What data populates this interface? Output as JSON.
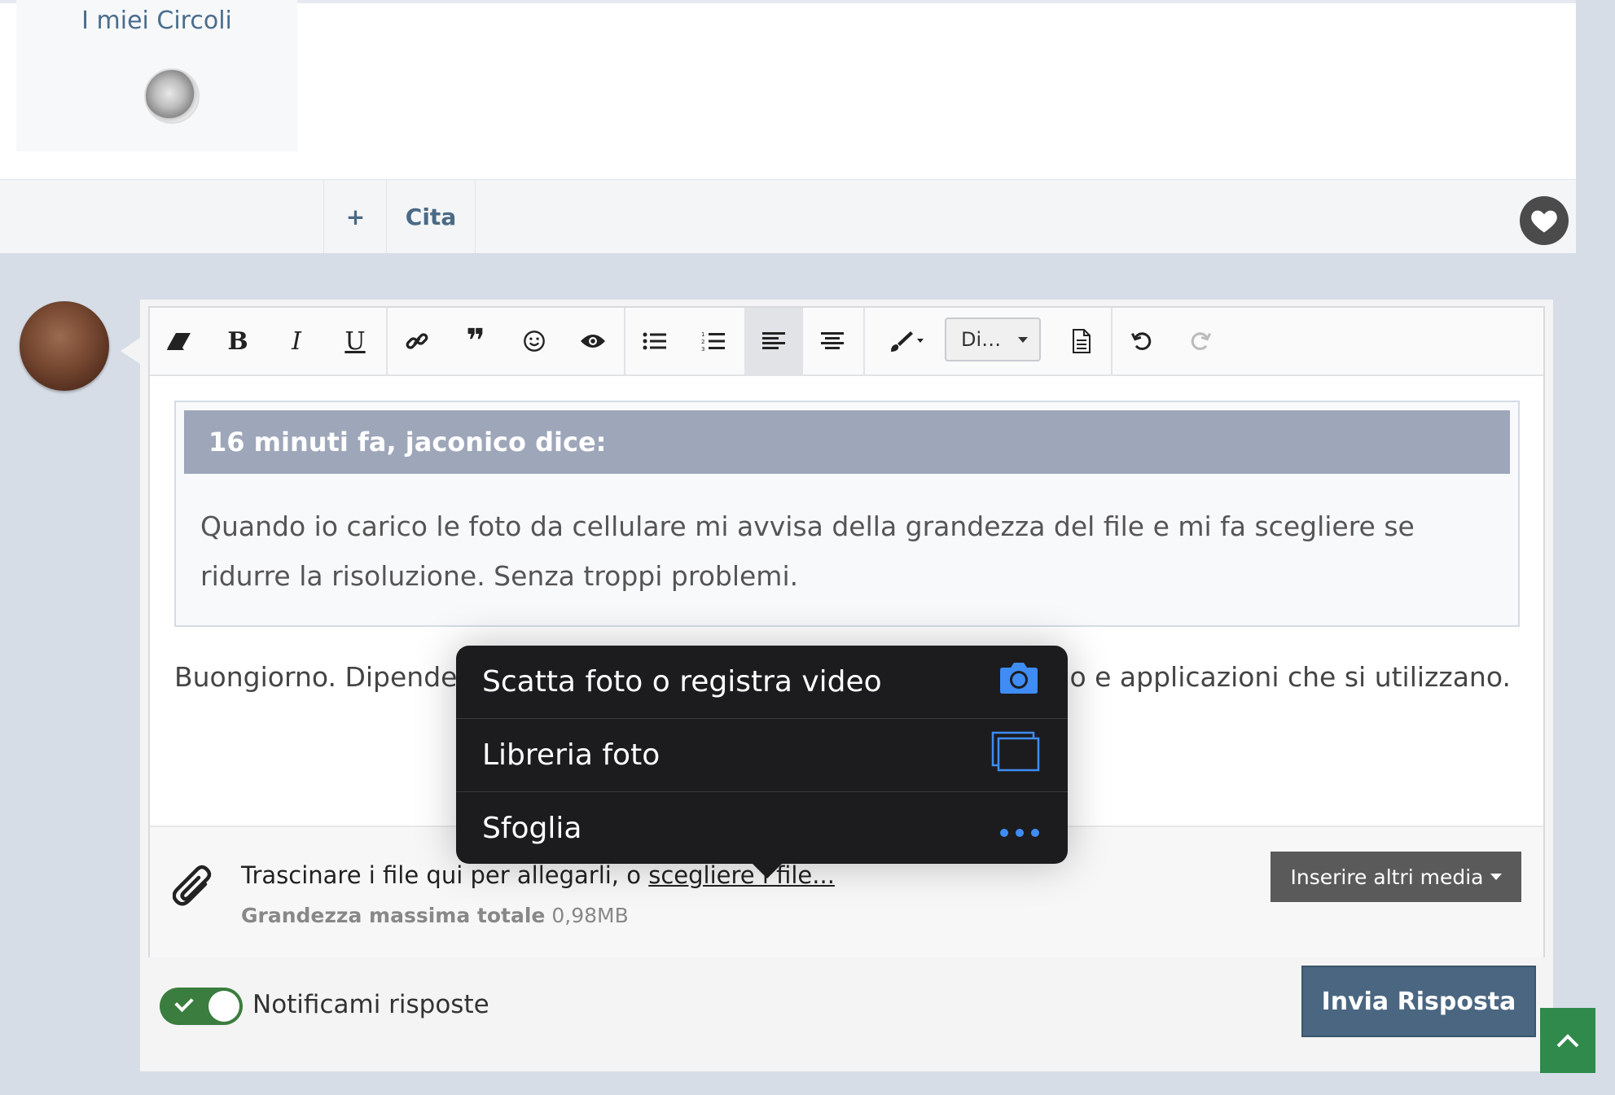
{
  "circles": {
    "title": "I miei Circoli"
  },
  "actions": {
    "plus": "+",
    "quote": "Cita"
  },
  "toolbar": {
    "font_select": "Di…",
    "items": [
      "eraser-icon",
      "bold",
      "italic",
      "underline",
      "link-icon",
      "quote-icon",
      "emoji-icon",
      "preview-icon",
      "bullet-list-icon",
      "numbered-list-icon",
      "align-left-icon",
      "align-center-icon",
      "paint-brush-icon",
      "font-select",
      "document-icon",
      "undo-icon",
      "redo-icon"
    ],
    "bold_label": "B",
    "italic_label": "I",
    "underline_label": "U"
  },
  "quote": {
    "header": "16 minuti fa, jaconico dice:",
    "body": "Quando io carico le foto da cellulare mi avvisa della grandezza del file e mi fa scegliere se ridurre la risoluzione. Senza troppi problemi."
  },
  "reply": {
    "text_start": "Buongiorno. Dipende",
    "text_end": "o e applicazioni che si utilizzano."
  },
  "attach": {
    "text": "Trascinare i file qui per allegarli, o ",
    "link": "scegliere i file...",
    "max_label": "Grandezza massima totale",
    "max_value": " 0,98MB",
    "more_media": "Inserire altri media"
  },
  "notify": {
    "label": "Notificami risposte",
    "enabled": true
  },
  "send": {
    "label": "Invia Risposta"
  },
  "ios_menu": {
    "items": [
      {
        "label": "Scatta foto o registra video",
        "icon": "camera-icon"
      },
      {
        "label": "Libreria foto",
        "icon": "photo-library-icon"
      },
      {
        "label": "Sfoglia",
        "icon": "more-dots-icon"
      }
    ]
  },
  "colors": {
    "accent": "#4a6680",
    "toggle": "#3a7d3e",
    "quote_header": "#9ea6b9",
    "ios_blue": "#3f8cf4"
  }
}
